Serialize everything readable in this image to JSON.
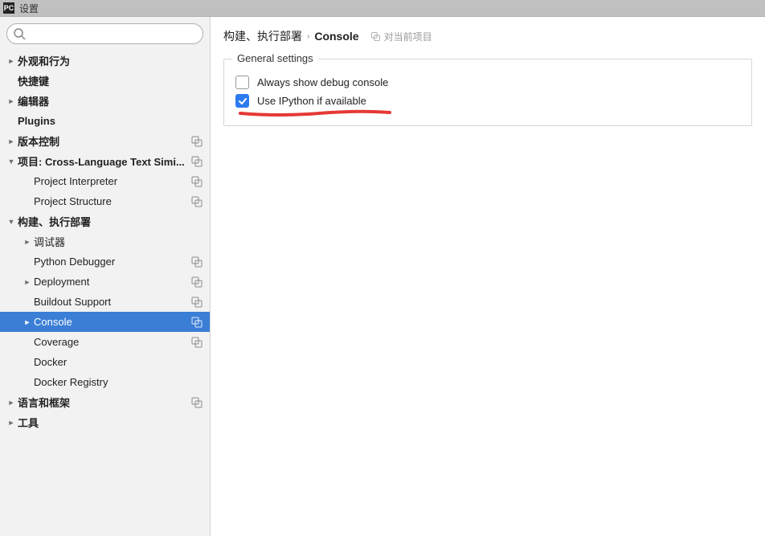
{
  "title": "设置",
  "search_placeholder": "",
  "sidebar": [
    {
      "label": "外观和行为",
      "level": 0,
      "arrow": "right",
      "bold": true,
      "copy": false
    },
    {
      "label": "快捷键",
      "level": 0,
      "arrow": "",
      "bold": true,
      "copy": false
    },
    {
      "label": "编辑器",
      "level": 0,
      "arrow": "right",
      "bold": true,
      "copy": false
    },
    {
      "label": "Plugins",
      "level": 0,
      "arrow": "",
      "bold": true,
      "copy": false
    },
    {
      "label": "版本控制",
      "level": 0,
      "arrow": "right",
      "bold": true,
      "copy": true
    },
    {
      "label": "项目: Cross-Language  Text  Simi...",
      "level": 0,
      "arrow": "down",
      "bold": true,
      "copy": true
    },
    {
      "label": "Project Interpreter",
      "level": 1,
      "arrow": "",
      "bold": false,
      "copy": true
    },
    {
      "label": "Project Structure",
      "level": 1,
      "arrow": "",
      "bold": false,
      "copy": true
    },
    {
      "label": "构建、执行部署",
      "level": 0,
      "arrow": "down",
      "bold": true,
      "copy": false
    },
    {
      "label": "调试器",
      "level": 1,
      "arrow": "right",
      "bold": false,
      "copy": false
    },
    {
      "label": "Python Debugger",
      "level": 1,
      "arrow": "",
      "bold": false,
      "copy": true
    },
    {
      "label": "Deployment",
      "level": 1,
      "arrow": "right",
      "bold": false,
      "copy": true
    },
    {
      "label": "Buildout Support",
      "level": 1,
      "arrow": "",
      "bold": false,
      "copy": true
    },
    {
      "label": "Console",
      "level": 1,
      "arrow": "right",
      "bold": false,
      "copy": true,
      "selected": true
    },
    {
      "label": "Coverage",
      "level": 1,
      "arrow": "",
      "bold": false,
      "copy": true
    },
    {
      "label": "Docker",
      "level": 1,
      "arrow": "",
      "bold": false,
      "copy": false
    },
    {
      "label": "Docker Registry",
      "level": 1,
      "arrow": "",
      "bold": false,
      "copy": false
    },
    {
      "label": "语言和框架",
      "level": 0,
      "arrow": "right",
      "bold": true,
      "copy": true
    },
    {
      "label": "工具",
      "level": 0,
      "arrow": "right",
      "bold": true,
      "copy": false
    }
  ],
  "breadcrumb": {
    "part1": "构建、执行部署",
    "part2": "Console",
    "scope": "对当前项目"
  },
  "settings": {
    "group_title": "General settings",
    "opt1": {
      "label": "Always show debug console",
      "checked": false
    },
    "opt2": {
      "label": "Use IPython if available",
      "checked": true
    }
  }
}
